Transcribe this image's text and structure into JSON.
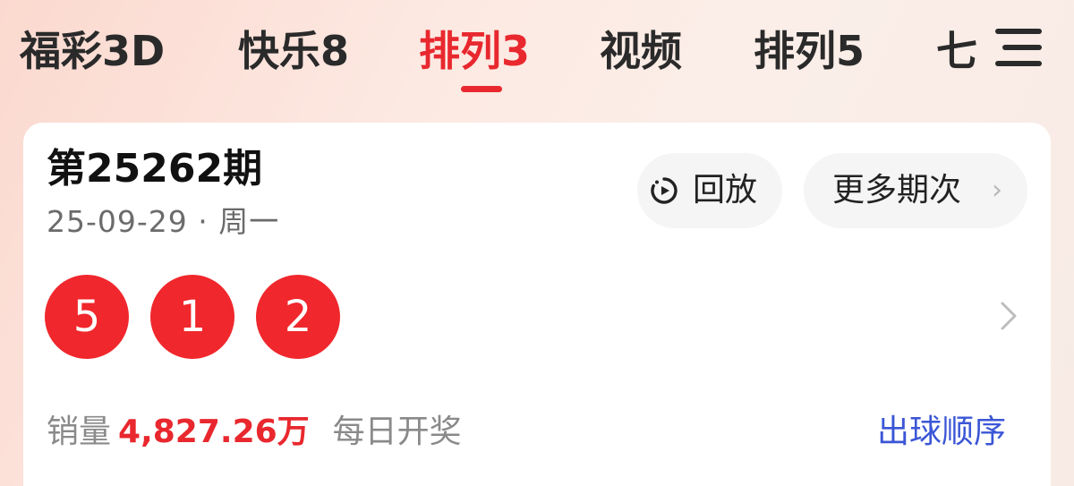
{
  "tabs": [
    {
      "label": "福彩3D",
      "active": false
    },
    {
      "label": "快乐8",
      "active": false
    },
    {
      "label": "排列3",
      "active": true
    },
    {
      "label": "视频",
      "active": false
    },
    {
      "label": "排列5",
      "active": false
    },
    {
      "label": "七",
      "active": false
    }
  ],
  "colors": {
    "accent": "#e8282e",
    "ball": "#f0272c",
    "link": "#3b56d6"
  },
  "card": {
    "issue": "第25262期",
    "date": "25-09-29 · 周一",
    "replay_label": "回放",
    "replay_icon": "replay-icon",
    "more_label": "更多期次",
    "more_icon": "chevron-right-icon",
    "balls": [
      "5",
      "1",
      "2"
    ],
    "sales_label": "销量",
    "sales_value": "4,827.26万",
    "draw_frequency": "每日开奖",
    "ball_order_label": "出球顺序"
  }
}
